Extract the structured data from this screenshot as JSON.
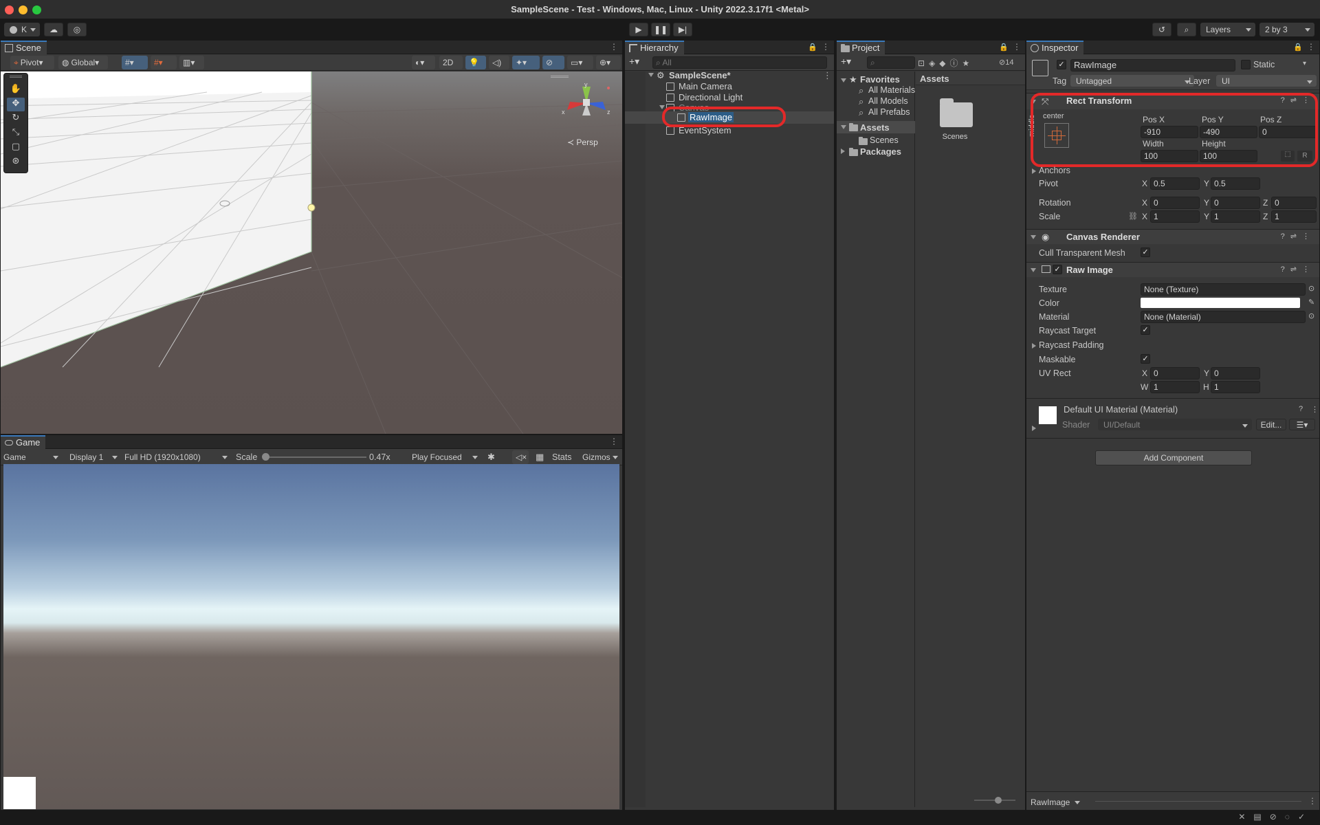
{
  "window": {
    "title": "SampleScene - Test - Windows, Mac, Linux - Unity 2022.3.17f1 <Metal>"
  },
  "toolbar": {
    "account": "K",
    "layers": "Layers",
    "layout": "2 by 3"
  },
  "scene": {
    "tab": "Scene",
    "pivot": "Pivot",
    "global": "Global",
    "mode_2d": "2D",
    "persp": "Persp",
    "gizmo_axes": {
      "y": "y",
      "x": "x",
      "z": "z"
    }
  },
  "game": {
    "tab": "Game",
    "mode": "Game",
    "display": "Display 1",
    "resolution": "Full HD (1920x1080)",
    "scale_label": "Scale",
    "scale_value": "0.47x",
    "scale_slider": 0.0,
    "play_mode": "Play Focused",
    "stats": "Stats",
    "gizmos": "Gizmos"
  },
  "hierarchy": {
    "tab": "Hierarchy",
    "search_placeholder": "All",
    "items": [
      {
        "label": "SampleScene*"
      },
      {
        "label": "Main Camera"
      },
      {
        "label": "Directional Light"
      },
      {
        "label": "Canvas"
      },
      {
        "label": "RawImage"
      },
      {
        "label": "EventSystem"
      }
    ]
  },
  "project": {
    "tab": "Project",
    "hidden_count": "14",
    "favorites": "Favorites",
    "fav_items": [
      "All Materials",
      "All Models",
      "All Prefabs"
    ],
    "assets": "Assets",
    "scenes": "Scenes",
    "packages": "Packages",
    "breadcrumb": "Assets",
    "grid_items": [
      {
        "label": "Scenes"
      }
    ]
  },
  "inspector": {
    "tab": "Inspector",
    "object_name": "RawImage",
    "static": "Static",
    "tag_label": "Tag",
    "tag": "Untagged",
    "layer_label": "Layer",
    "layer": "UI",
    "rect": {
      "title": "Rect Transform",
      "anchor_h": "center",
      "anchor_v": "middle",
      "posx_label": "Pos X",
      "posx": "-910",
      "posy_label": "Pos Y",
      "posy": "-490",
      "posz_label": "Pos Z",
      "posz": "0",
      "width_label": "Width",
      "width": "100",
      "height_label": "Height",
      "height": "100",
      "r_btn": "R",
      "anchors": "Anchors",
      "pivot_label": "Pivot",
      "pivot_x": "0.5",
      "pivot_y": "0.5",
      "rotation_label": "Rotation",
      "rot_x": "0",
      "rot_y": "0",
      "rot_z": "0",
      "scale_label": "Scale",
      "scale_x": "1",
      "scale_y": "1",
      "scale_z": "1",
      "x": "X",
      "y": "Y",
      "z": "Z"
    },
    "canvas_renderer": {
      "title": "Canvas Renderer",
      "cull": "Cull Transparent Mesh"
    },
    "raw_image": {
      "title": "Raw Image",
      "texture_label": "Texture",
      "texture": "None (Texture)",
      "color_label": "Color",
      "color": "#ffffff",
      "material_label": "Material",
      "material": "None (Material)",
      "raycast_target": "Raycast Target",
      "raycast_padding": "Raycast Padding",
      "maskable": "Maskable",
      "uvrect_label": "UV Rect",
      "uv_x": "0",
      "uv_y": "0",
      "uv_w": "1",
      "uv_h": "1",
      "w": "W",
      "h": "H"
    },
    "material_block": {
      "title": "Default UI Material (Material)",
      "shader_label": "Shader",
      "shader": "UI/Default",
      "edit": "Edit..."
    },
    "add_component": "Add Component",
    "footer_object": "RawImage"
  },
  "colors": {
    "accent": "#3a79bb",
    "highlight": "#e32929",
    "selection": "#2c5d87"
  }
}
